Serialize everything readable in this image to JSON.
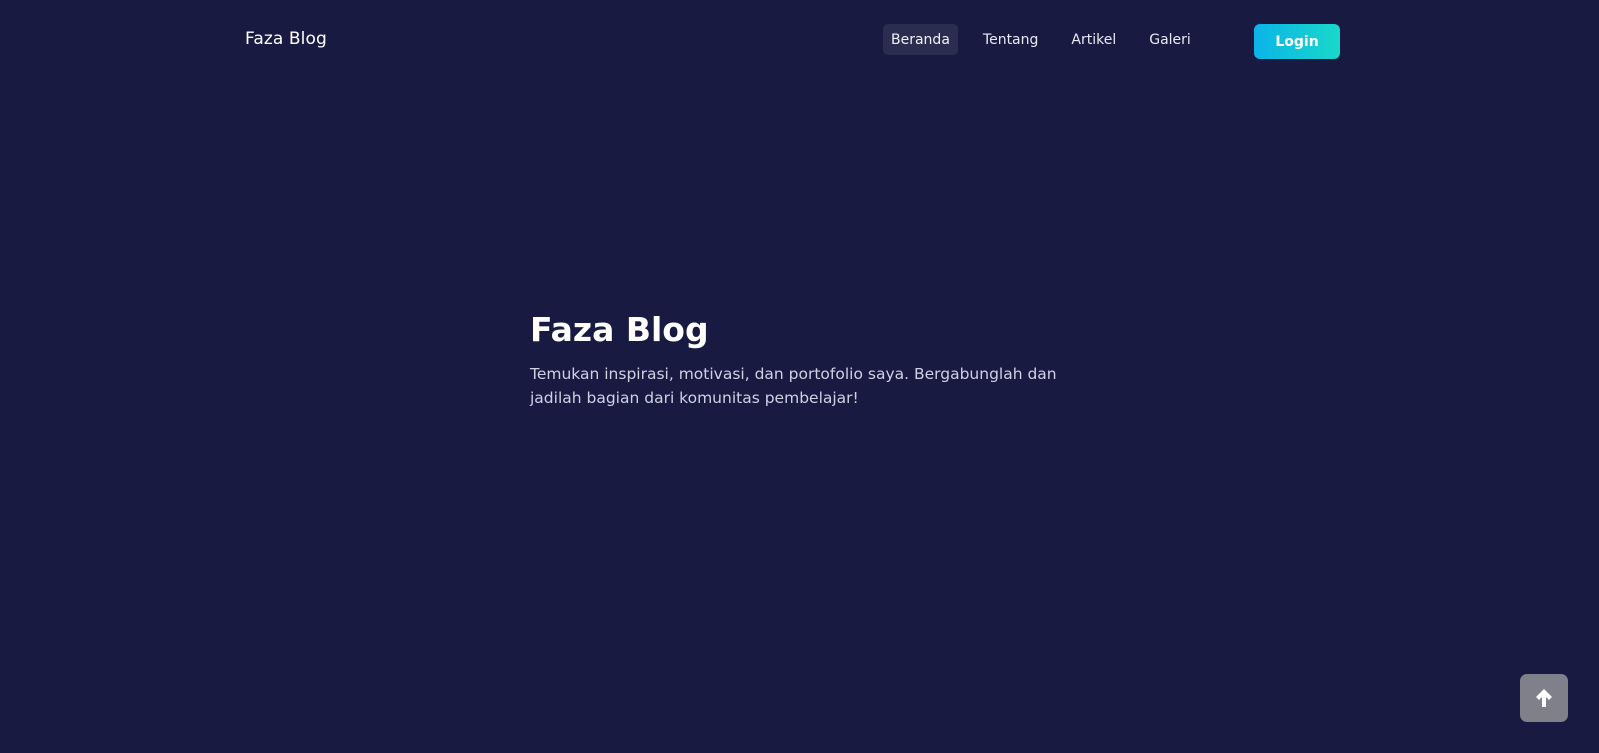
{
  "navbar": {
    "brand": "Faza Blog",
    "items": [
      {
        "label": "Beranda",
        "active": true
      },
      {
        "label": "Tentang",
        "active": false
      },
      {
        "label": "Artikel",
        "active": false
      },
      {
        "label": "Galeri",
        "active": false
      }
    ],
    "login_label": "Login"
  },
  "hero": {
    "title": "Faza Blog",
    "text": "Temukan inspirasi, motivasi, dan portofolio saya. Bergabunglah dan jadilah bagian dari komunitas pembelajar!"
  },
  "back_to_top": {
    "icon": "arrow-up-icon"
  },
  "colors": {
    "background": "#181a42",
    "nav_active_bg": "#2a2c50",
    "login_gradient_start": "#0bb4e8",
    "login_gradient_end": "#19d8c9",
    "back_to_top_bg": "#7f8089"
  }
}
